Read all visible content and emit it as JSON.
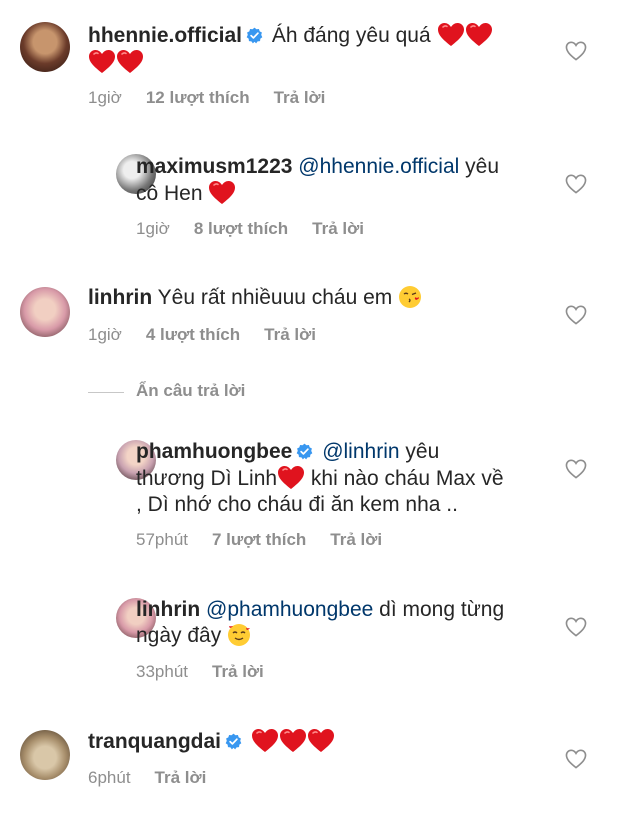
{
  "comments": [
    {
      "username": "hhennie.official",
      "verified": true,
      "text": "Áh đáng yêu quá",
      "time": "1giờ",
      "likes": "12 lượt thích",
      "reply": "Trả lời",
      "avatar_colors": [
        "#6b3b2a",
        "#c7956d"
      ]
    },
    {
      "username": "maximusm1223",
      "mention": "@hhennie.official",
      "text_1": "yêu",
      "text_2": "cô Hen",
      "time": "1giờ",
      "likes": "8 lượt thích",
      "reply": "Trả lời"
    },
    {
      "username": "linhrin",
      "text": "Yêu rất nhiềuuu cháu em",
      "time": "1giờ",
      "likes": "4 lượt thích",
      "reply": "Trả lời"
    },
    {
      "hide_replies": "Ẩn câu trả lời"
    },
    {
      "username": "phamhuongbee",
      "verified": true,
      "mention": "@linhrin",
      "text_1": "yêu",
      "text_2a": "thương Dì Linh",
      "text_2b": "khi nào cháu Max về",
      "text_3": ", Dì nhớ cho cháu đi ăn kem nha ..",
      "time": "57phút",
      "likes": "7 lượt thích",
      "reply": "Trả lời"
    },
    {
      "username": "linhrin",
      "mention": "@phamhuongbee",
      "text_1": "dì mong từng",
      "text_2": "ngày đây",
      "time": "33phút",
      "reply": "Trả lời"
    },
    {
      "username": "tranquangdai",
      "verified": true,
      "time": "6phút",
      "reply": "Trả lời"
    }
  ],
  "colors": {
    "heart": "#ed1c24",
    "verified": "#3897f0",
    "mention": "#00376b",
    "meta": "#8e8e8e"
  }
}
